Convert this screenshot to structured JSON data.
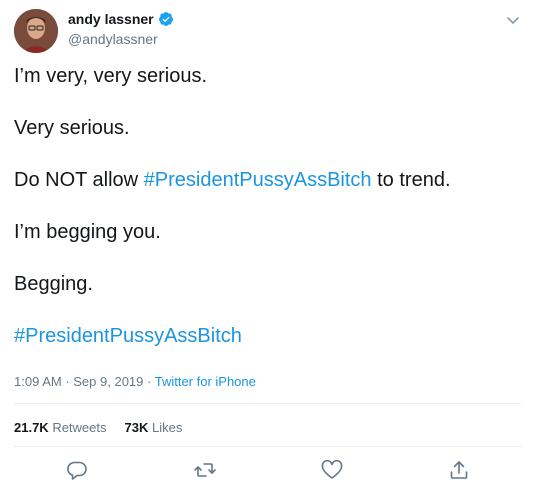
{
  "author": {
    "display_name": "andy lassner",
    "handle": "@andylassner",
    "verified": true
  },
  "tweet": {
    "p1": "I’m very, very serious.",
    "p2": "Very serious.",
    "p3_before": "Do NOT allow ",
    "p3_hashtag": "#PresidentPussyAssBitch",
    "p3_after": " to trend.",
    "p4": "I’m begging you.",
    "p5": "Begging.",
    "p6_hashtag": "#PresidentPussyAssBitch"
  },
  "meta": {
    "time": "1:09 AM",
    "date": "Sep 9, 2019",
    "source": "Twitter for iPhone",
    "separator": " · "
  },
  "stats": {
    "retweets_count": "21.7K",
    "retweets_label": " Retweets",
    "likes_count": "73K",
    "likes_label": " Likes"
  },
  "colors": {
    "link": "#1b95e0",
    "text": "#14171a",
    "secondary": "#657786",
    "divider": "#e6ecf0"
  },
  "icons": {
    "reply": "reply-icon",
    "retweet": "retweet-icon",
    "like": "heart-icon",
    "share": "share-icon",
    "more": "chevron-down-icon",
    "verified": "verified-badge-icon"
  }
}
